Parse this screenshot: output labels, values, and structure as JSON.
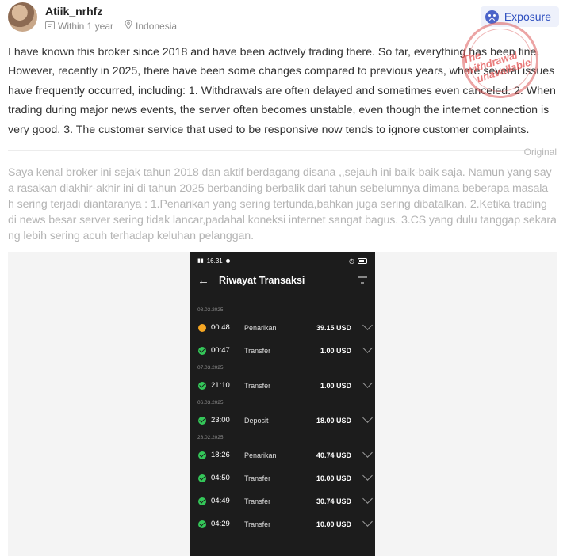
{
  "user": {
    "name": "Atiik_nrhfz",
    "time": "Within 1 year",
    "location": "Indonesia"
  },
  "badge": {
    "label": "Exposure",
    "icon": "sad-face-icon"
  },
  "stamp": {
    "line1": "The withdrawal",
    "line2": "unavailable",
    "color": "#e05a5a"
  },
  "review": {
    "translated": "I have known this broker since 2018 and have been actively trading there. So far, everything has been fine. However, recently in 2025, there have been some changes compared to previous years, where several issues have frequently occurred, including: 1. Withdrawals are often delayed and sometimes even canceled. 2. When trading during major news events, the server often becomes unstable, even though the internet connection is very good. 3. The customer service that used to be responsive now tends to ignore customer complaints.",
    "original_label": "Original",
    "original": "Saya kenal broker ini sejak tahun 2018 dan aktif berdagang disana ,,sejauh ini baik-baik saja. Namun yang say a rasakan diakhir-akhir ini di tahun 2025 berbanding berbalik dari tahun sebelumnya dimana beberapa masala h sering terjadi diantaranya : 1.Penarikan yang sering tertunda,bahkan juga sering dibatalkan. 2.Ketika trading di news besar server sering tidak lancar,padahal koneksi internet sangat bagus. 3.CS yang dulu tanggap sekara ng lebih sering acuh terhadap keluhan pelanggan."
  },
  "phone": {
    "status_time": "16.31",
    "title": "Riwayat Transaksi",
    "groups": [
      {
        "date": "08.03.2025",
        "rows": [
          {
            "status": "pending",
            "time": "00:48",
            "type": "Penarikan",
            "amount": "39.15 USD"
          },
          {
            "status": "done",
            "time": "00:47",
            "type": "Transfer",
            "amount": "1.00 USD"
          }
        ]
      },
      {
        "date": "07.03.2025",
        "rows": [
          {
            "status": "done",
            "time": "21:10",
            "type": "Transfer",
            "amount": "1.00 USD"
          }
        ]
      },
      {
        "date": "06.03.2025",
        "rows": [
          {
            "status": "done",
            "time": "23:00",
            "type": "Deposit",
            "amount": "18.00 USD"
          }
        ]
      },
      {
        "date": "28.02.2025",
        "rows": [
          {
            "status": "done",
            "time": "18:26",
            "type": "Penarikan",
            "amount": "40.74 USD"
          },
          {
            "status": "done",
            "time": "04:50",
            "type": "Transfer",
            "amount": "10.00 USD"
          },
          {
            "status": "done",
            "time": "04:49",
            "type": "Transfer",
            "amount": "30.74 USD"
          },
          {
            "status": "done",
            "time": "04:29",
            "type": "Transfer",
            "amount": "10.00 USD"
          }
        ]
      }
    ]
  }
}
